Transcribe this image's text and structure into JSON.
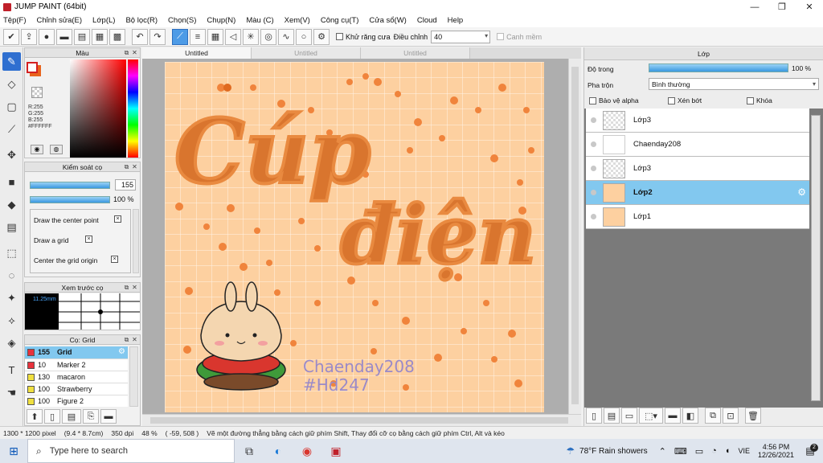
{
  "window": {
    "title": "JUMP PAINT (64bit)",
    "minimize": "—",
    "maximize": "❐",
    "close": "✕"
  },
  "menu": [
    "Tệp(F)",
    "Chỉnh sửa(E)",
    "Lớp(L)",
    "Bộ lọc(R)",
    "Chọn(S)",
    "Chụp(N)",
    "Màu (C)",
    "Xem(V)",
    "Công cụ(T)",
    "Cửa sổ(W)",
    "Cloud",
    "Help"
  ],
  "toolbar": {
    "antialias_label": "Khử răng cưa",
    "adjust_label": "Điều chỉnh",
    "adjust_value": "40",
    "snap_label": "Canh mềm"
  },
  "tabs": [
    "Untitled",
    "Untitled",
    "Untitled"
  ],
  "color_panel": {
    "title": "Màu",
    "r": "R:255",
    "g": "G:255",
    "b": "B:255",
    "hex": "#FFFFFF",
    "primary": "#ffffff",
    "secondary": "#e8641c"
  },
  "brush_control": {
    "title": "Kiểm soát cọ",
    "size_value": "155",
    "opacity_value": "100 %",
    "items": [
      "Draw the center point",
      "Draw a grid",
      "Center the grid origin"
    ]
  },
  "brush_preview": {
    "title": "Xem trước cọ",
    "size_label": "11.25mm"
  },
  "brush_list": {
    "title": "Cọ: Grid",
    "items": [
      {
        "size": "155",
        "name": "Grid",
        "color": "#e8323c"
      },
      {
        "size": "10",
        "name": "Marker 2",
        "color": "#e8323c"
      },
      {
        "size": "130",
        "name": "macaron",
        "color": "#f0e040"
      },
      {
        "size": "100",
        "name": "Strawberry",
        "color": "#f0e040"
      },
      {
        "size": "100",
        "name": "Figure 2",
        "color": "#f0e040"
      }
    ]
  },
  "artwork": {
    "title_line1": "Cúp",
    "title_line2": "điện",
    "watermark1": "Chaenday208",
    "watermark2": "#Hd247"
  },
  "layer_panel": {
    "title": "Lớp",
    "opacity_label": "Độ trong",
    "opacity_value": "100 %",
    "blend_label": "Pha trộn",
    "blend_value": "Bình thường",
    "protect_alpha": "Bảo vệ alpha",
    "clip": "Xén bớt",
    "lock": "Khóa",
    "layers": [
      "Lớp3",
      "Chaenday208",
      "Lớp3",
      "Lớp2",
      "Lớp1"
    ]
  },
  "status": {
    "size": "1300 * 1200 pixel",
    "cm": "(9.4 * 8.7cm)",
    "dpi": "350 dpi",
    "zoom": "48 %",
    "coords": "( -59, 508 )",
    "hint": "Vẽ một đường thẳng bằng cách giữ phím Shift, Thay đổi cỡ cọ bằng cách giữ phím Ctrl, Alt và kéo"
  },
  "taskbar": {
    "search_placeholder": "Type here to search",
    "weather": "78°F  Rain showers",
    "lang": "VIE",
    "time": "4:56 PM",
    "date": "12/26/2021",
    "notif_count": "2"
  }
}
